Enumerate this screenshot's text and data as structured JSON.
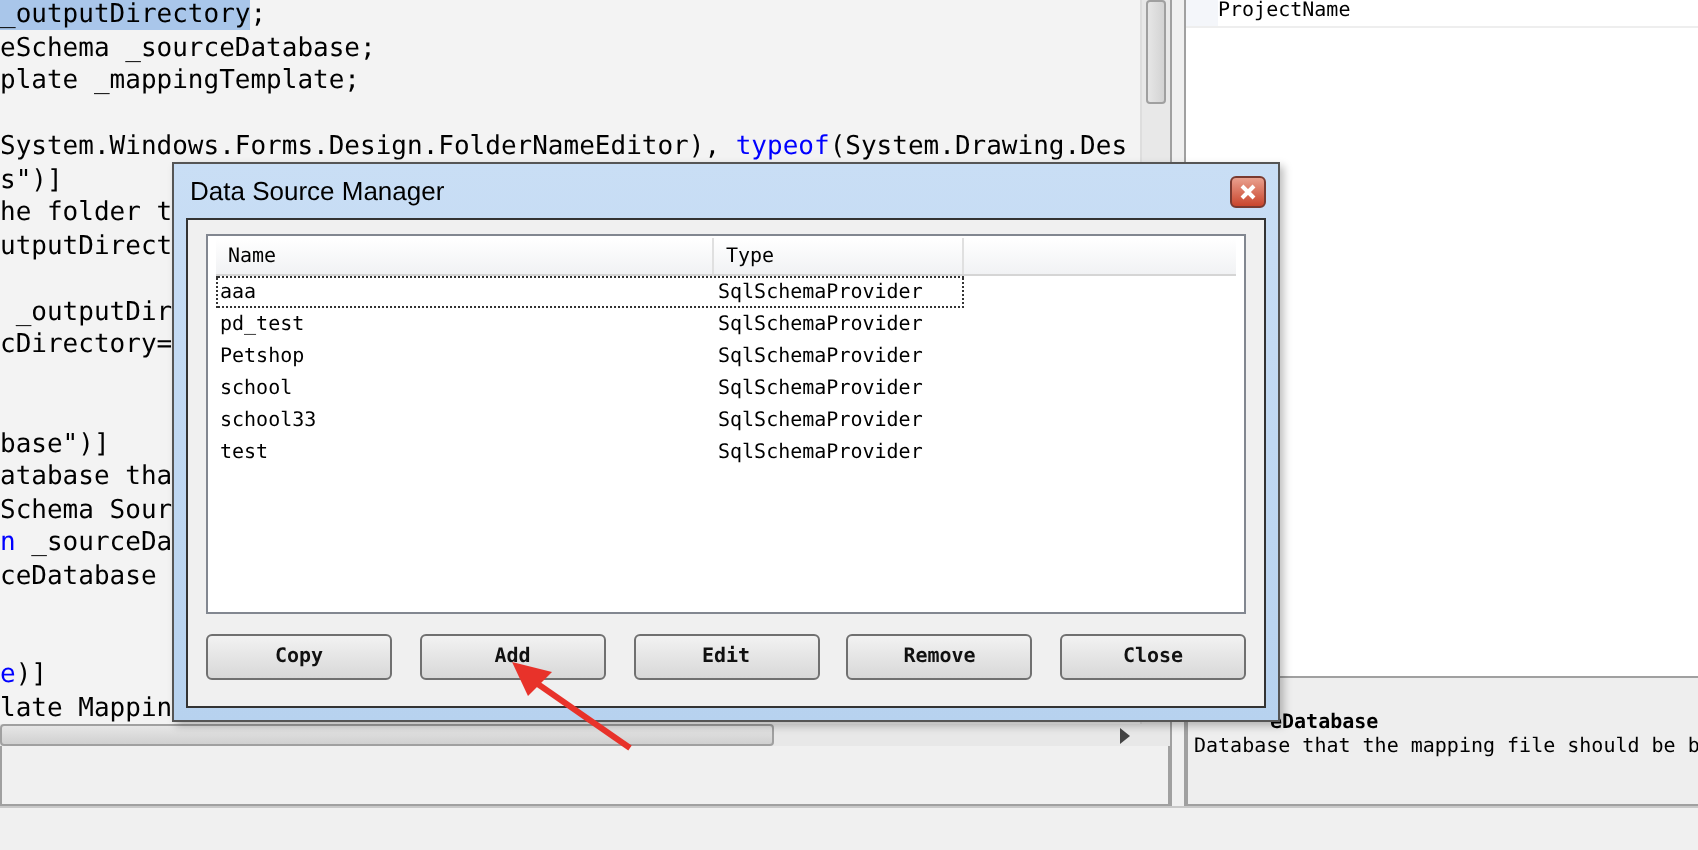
{
  "code_editor": {
    "lines": [
      {
        "kind": "code",
        "segments": [
          {
            "text": "_outputDirectory",
            "kind": "selected"
          },
          {
            "text": ";",
            "kind": "plain"
          }
        ]
      },
      {
        "kind": "code",
        "segments": [
          {
            "text": "eSchema _sourceDatabase;",
            "kind": "plain"
          }
        ]
      },
      {
        "kind": "code",
        "segments": [
          {
            "text": "plate _mappingTemplate;",
            "kind": "plain"
          }
        ]
      },
      {
        "kind": "blank"
      },
      {
        "kind": "code",
        "segments": [
          {
            "text": "System.Windows.Forms.Design.FolderNameEditor), ",
            "kind": "plain"
          },
          {
            "text": "typeof",
            "kind": "keyword"
          },
          {
            "text": "(System.Drawing.Des",
            "kind": "plain"
          }
        ]
      },
      {
        "kind": "code",
        "segments": [
          {
            "text": "s\")]",
            "kind": "plain"
          }
        ]
      },
      {
        "kind": "code",
        "segments": [
          {
            "text": "he folder t",
            "kind": "plain"
          }
        ]
      },
      {
        "kind": "code",
        "segments": [
          {
            "text": "utputDirect",
            "kind": "plain"
          }
        ]
      },
      {
        "kind": "blank"
      },
      {
        "kind": "code",
        "segments": [
          {
            "text": " _outputDir",
            "kind": "plain"
          }
        ]
      },
      {
        "kind": "code",
        "segments": [
          {
            "text": "cDirectory=",
            "kind": "plain"
          }
        ]
      },
      {
        "kind": "blank"
      },
      {
        "kind": "blank"
      },
      {
        "kind": "code",
        "segments": [
          {
            "text": "base\")]",
            "kind": "plain"
          }
        ]
      },
      {
        "kind": "code",
        "segments": [
          {
            "text": "atabase tha",
            "kind": "plain"
          }
        ]
      },
      {
        "kind": "code",
        "segments": [
          {
            "text": "Schema Sour",
            "kind": "plain"
          }
        ]
      },
      {
        "kind": "code",
        "segments": [
          {
            "text": "n",
            "kind": "keyword"
          },
          {
            "text": " _sourceDa",
            "kind": "plain"
          }
        ]
      },
      {
        "kind": "code",
        "segments": [
          {
            "text": "ceDatabase",
            "kind": "plain"
          }
        ]
      },
      {
        "kind": "blank"
      },
      {
        "kind": "blank"
      },
      {
        "kind": "code",
        "segments": [
          {
            "text": "e",
            "kind": "keyword"
          },
          {
            "text": ")]",
            "kind": "plain"
          }
        ]
      },
      {
        "kind": "code",
        "segments": [
          {
            "text": "late Mappin",
            "kind": "plain"
          }
        ]
      }
    ]
  },
  "property_grid": {
    "rows": [
      {
        "name": "ProjectName"
      }
    ],
    "description": {
      "title": "eDatabase",
      "text": "Database that the mapping file should be b"
    }
  },
  "dialog": {
    "title": "Data Source Manager",
    "columns": [
      "Name",
      "Type"
    ],
    "rows": [
      {
        "name": "aaa",
        "type": "SqlSchemaProvider",
        "focused": true
      },
      {
        "name": "pd_test",
        "type": "SqlSchemaProvider",
        "focused": false
      },
      {
        "name": "Petshop",
        "type": "SqlSchemaProvider",
        "focused": false
      },
      {
        "name": "school",
        "type": "SqlSchemaProvider",
        "focused": false
      },
      {
        "name": "school33",
        "type": "SqlSchemaProvider",
        "focused": false
      },
      {
        "name": "test",
        "type": "SqlSchemaProvider",
        "focused": false
      }
    ],
    "buttons": [
      "Copy",
      "Add",
      "Edit",
      "Remove",
      "Close"
    ]
  }
}
